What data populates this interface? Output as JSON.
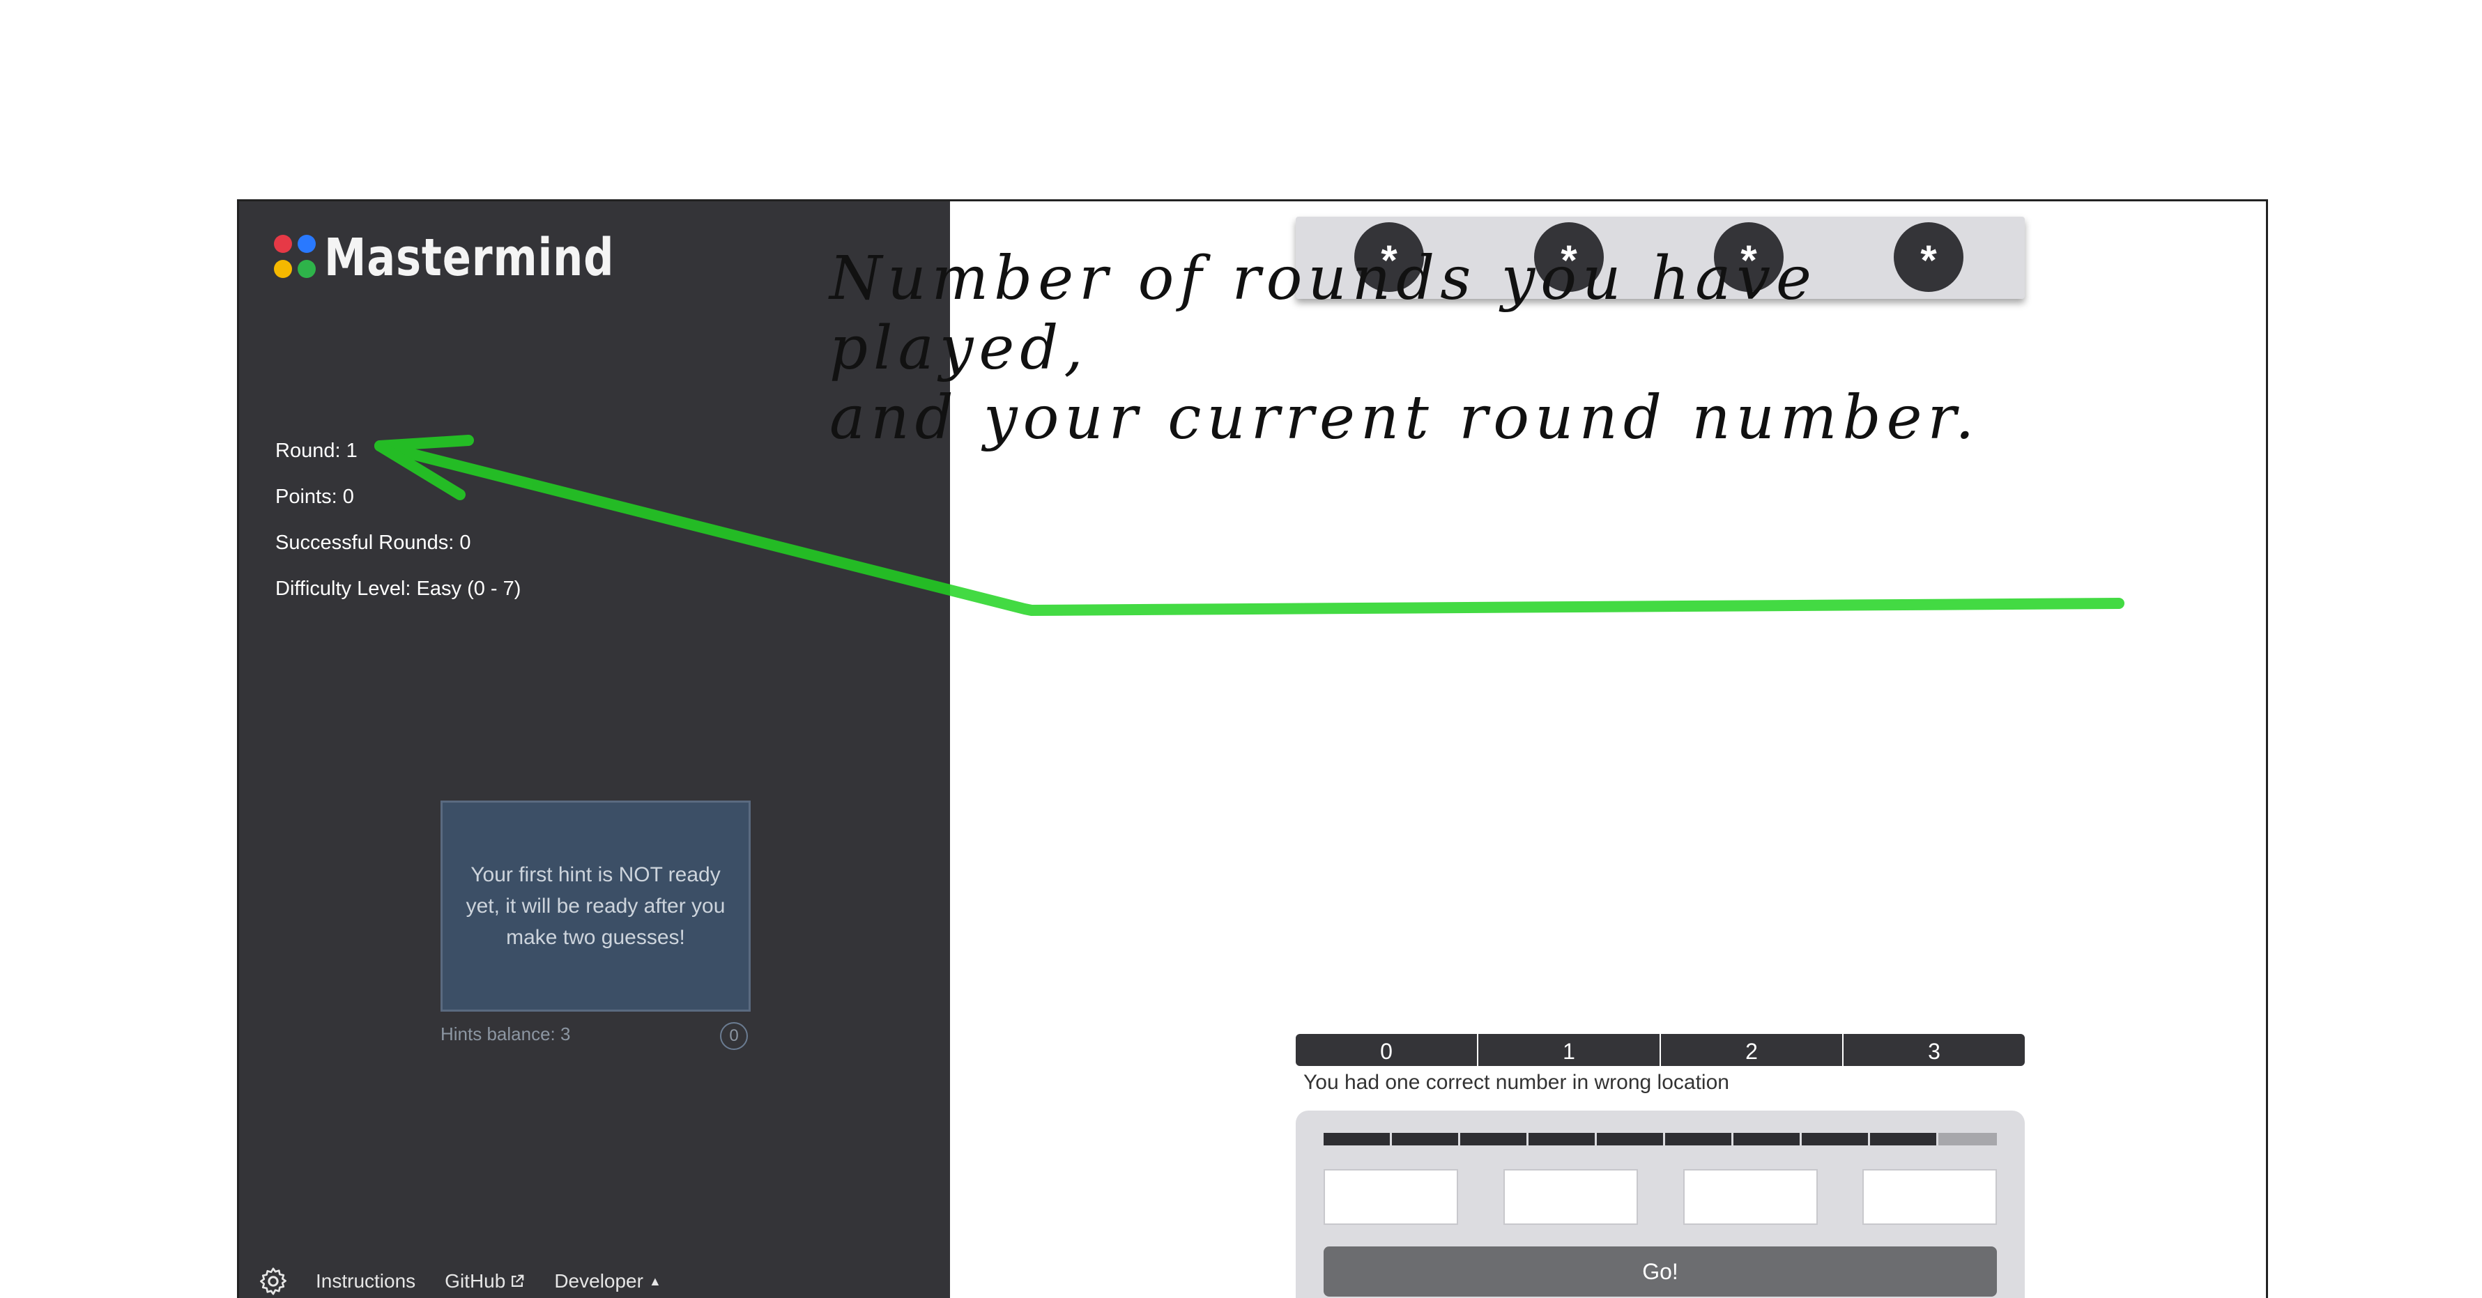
{
  "app": {
    "title": "Mastermind",
    "logo_colors": [
      "#e63946",
      "#2979ff",
      "#f5b800",
      "#2eb34a"
    ]
  },
  "stats": {
    "round": "Round: 1",
    "points": "Points: 0",
    "successful_rounds": "Successful Rounds: 0",
    "difficulty": "Difficulty Level: Easy (0 - 7)"
  },
  "hints": {
    "message": "Your first hint is NOT ready yet, it will be ready after you make two guesses!",
    "balance": "Hints balance: 3",
    "counter": "0"
  },
  "footer": {
    "settings_icon": "gear-icon",
    "instructions": "Instructions",
    "github": "GitHub",
    "developer": "Developer"
  },
  "secret": [
    "*",
    "*",
    "*",
    "*"
  ],
  "annotation": {
    "line1": "Number of rounds you have played,",
    "line2": "and your current round number.",
    "arrow_color": "#22d422"
  },
  "score_labels": [
    "0",
    "1",
    "2",
    "3"
  ],
  "feedback": "You had one correct number in wrong location",
  "guess": {
    "inputs": [
      "",
      "",
      "",
      ""
    ],
    "go_label": "Go!",
    "time_remaining_fraction": 0.9
  }
}
